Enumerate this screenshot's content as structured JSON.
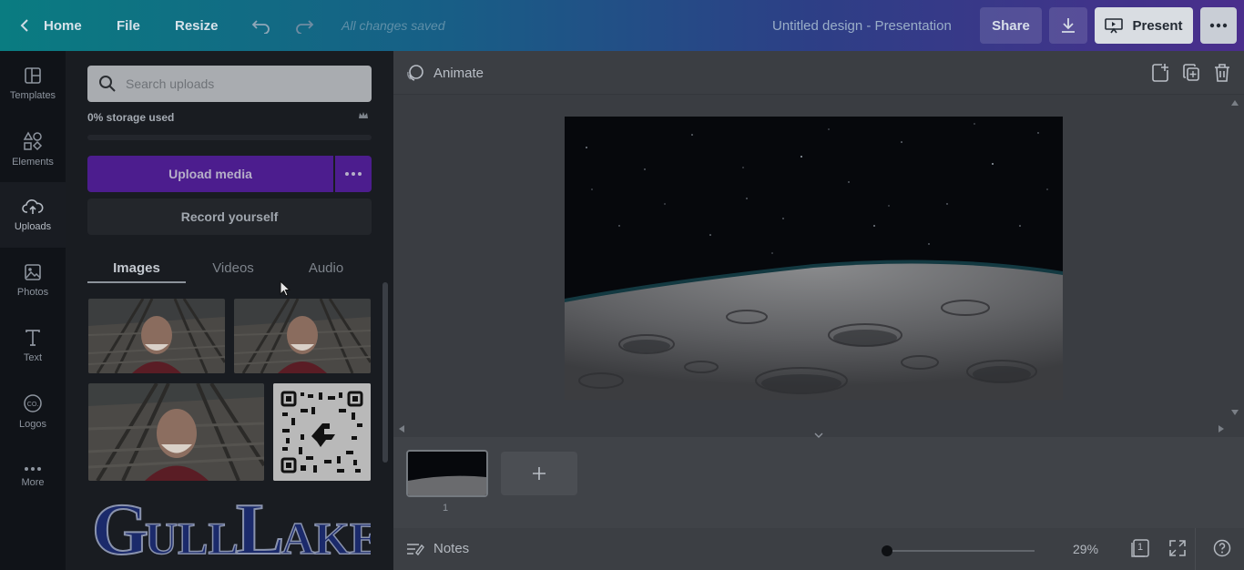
{
  "topbar": {
    "home": "Home",
    "file": "File",
    "resize": "Resize",
    "saved_status": "All changes saved",
    "design_title": "Untitled design - Presentation",
    "share": "Share",
    "present": "Present"
  },
  "rail": {
    "items": [
      {
        "label": "Templates",
        "icon": "templates-icon"
      },
      {
        "label": "Elements",
        "icon": "elements-icon"
      },
      {
        "label": "Uploads",
        "icon": "upload-cloud-icon"
      },
      {
        "label": "Photos",
        "icon": "photos-icon"
      },
      {
        "label": "Text",
        "icon": "text-icon"
      },
      {
        "label": "Logos",
        "icon": "logos-icon"
      },
      {
        "label": "More",
        "icon": "more-dots-icon"
      }
    ]
  },
  "panel": {
    "search_placeholder": "Search uploads",
    "storage_text": "0% storage used",
    "storage_used_percent": 0,
    "upload_button": "Upload media",
    "record_button": "Record yourself",
    "tabs": [
      "Images",
      "Videos",
      "Audio"
    ],
    "active_tab": "Images",
    "logo_text": "GULL LAKE"
  },
  "workspace": {
    "animate": "Animate",
    "slide_number": "1",
    "notes": "Notes",
    "zoom": "29%",
    "page_count": "1"
  },
  "colors": {
    "accent_purple": "#4c1d8e",
    "topbar_start": "#0a7c81",
    "topbar_end": "#4a2e8c",
    "logo_blue": "#1b2a6b"
  }
}
